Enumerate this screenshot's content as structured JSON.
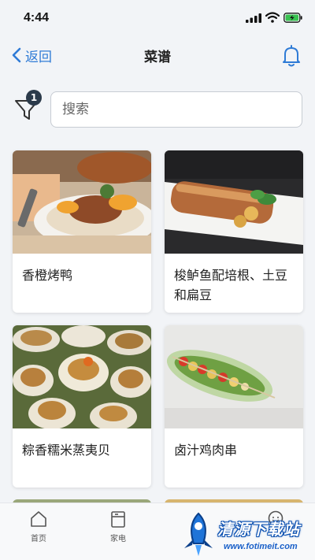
{
  "status_bar": {
    "time": "4:44"
  },
  "nav": {
    "back_label": "返回",
    "title": "菜谱"
  },
  "filter": {
    "badge_count": "1"
  },
  "search": {
    "placeholder": "搜索",
    "value": ""
  },
  "recipes": [
    {
      "title": "香橙烤鸭",
      "image_icon": "roast-duck-photo"
    },
    {
      "title": "梭鲈鱼配培根、土豆和扁豆",
      "image_icon": "pikeperch-bacon-photo"
    },
    {
      "title": "粽香糯米蒸夷贝",
      "image_icon": "steamed-scallops-photo"
    },
    {
      "title": "卤汁鸡肉串",
      "image_icon": "chicken-skewer-photo"
    }
  ],
  "tab_bar": {
    "tabs": [
      {
        "label": "首页",
        "icon": "home-icon"
      },
      {
        "label": "家电",
        "icon": "appliance-icon"
      },
      {
        "label": "",
        "icon": "chat-icon"
      }
    ]
  },
  "watermark": {
    "text": "清源下载站",
    "url": "www.fotimeit.com"
  },
  "colors": {
    "accent": "#2f7bd6",
    "background": "#f2f4f7",
    "badge": "#2b3a4a"
  }
}
